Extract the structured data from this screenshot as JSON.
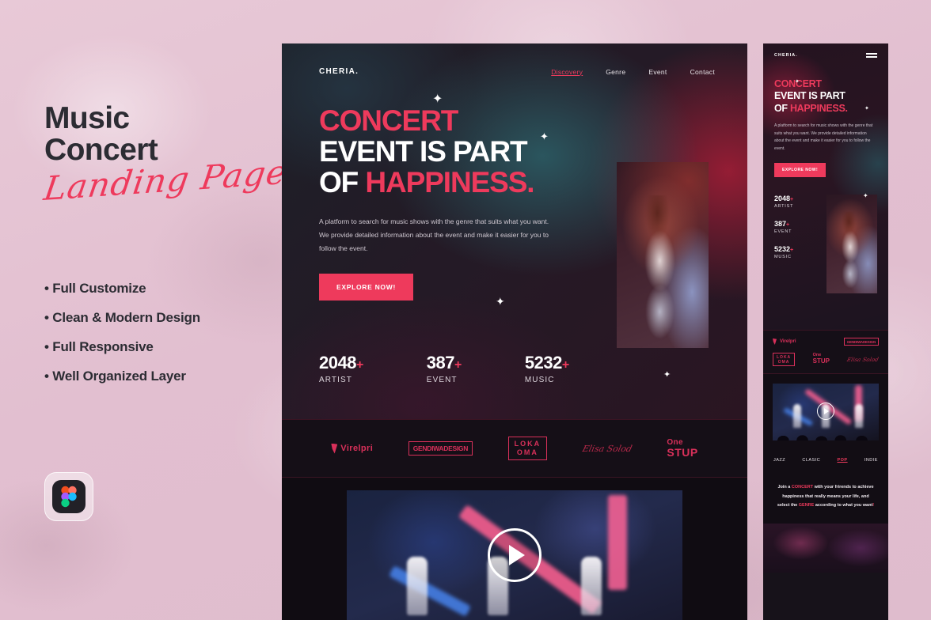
{
  "poster": {
    "title_line1": "Music",
    "title_line2": "Concert",
    "title_script": "Landing Page",
    "features": [
      "• Full Customize",
      "• Clean & Modern Design",
      "• Full Responsive",
      "• Well Organized Layer"
    ],
    "badge_icon": "figma-icon"
  },
  "colors": {
    "accent": "#ee3a5c",
    "background": "#e4c3d2",
    "dark": "#17121a",
    "text_dark": "#2c2c33"
  },
  "desktop": {
    "nav": {
      "brand": "CHERIA.",
      "links": [
        {
          "label": "Discovery",
          "active": true
        },
        {
          "label": "Genre",
          "active": false
        },
        {
          "label": "Event",
          "active": false
        },
        {
          "label": "Contact",
          "active": false
        }
      ]
    },
    "hero": {
      "headline_line1": "CONCERT",
      "headline_line2": "EVENT IS PART",
      "headline_line3_prefix": "OF ",
      "headline_line3_accent": "HAPPINESS.",
      "paragraph": "A platform to search for music shows with the genre that suits what you want. We provide detailed information about the event and make it easier for you to follow the event.",
      "cta": "EXPLORE NOW!",
      "image_alt": "concert-singer-photo"
    },
    "stats": [
      {
        "value": "2048",
        "plus": "+",
        "label": "ARTIST"
      },
      {
        "value": "387",
        "plus": "+",
        "label": "EVENT"
      },
      {
        "value": "5232",
        "plus": "+",
        "label": "MUSIC"
      }
    ],
    "logos": [
      {
        "name": "Virelpri",
        "style": "mark"
      },
      {
        "name": "GENDIWADESIGN",
        "style": "boxed"
      },
      {
        "name_line1": "LOKA",
        "name_line2": "OMA",
        "style": "loka"
      },
      {
        "name": "Elisa Solod",
        "style": "script"
      },
      {
        "name_line1": "One",
        "name_line2": "STUP",
        "style": "onestup"
      }
    ],
    "video": {
      "play_label": "play-button"
    }
  },
  "mobile": {
    "nav": {
      "brand": "CHERIA.",
      "menu_icon": "hamburger-menu-icon"
    },
    "hero": {
      "headline_line1": "CONCERT",
      "headline_line2": "EVENT IS PART",
      "headline_line3_prefix": "OF ",
      "headline_line3_accent": "HAPPINESS.",
      "paragraph": "A platform to search for music shows with the genre that suits what you want. We provide detailed information about the event and make it easier for you to follow the event.",
      "cta": "EXPLORE NOW!"
    },
    "stats": [
      {
        "value": "2048",
        "plus": "+",
        "label": "ARTIST"
      },
      {
        "value": "387",
        "plus": "+",
        "label": "EVENT"
      },
      {
        "value": "5232",
        "plus": "+",
        "label": "MUSIC"
      }
    ],
    "logos_row1": [
      {
        "name": "Virelpri",
        "style": "mark"
      },
      {
        "name": "GENDIWADESIGN",
        "style": "boxed"
      }
    ],
    "logos_row2": [
      {
        "name_line1": "LOKA",
        "name_line2": "OMA",
        "style": "loka"
      },
      {
        "name_line1": "One",
        "name_line2": "STUP",
        "style": "onestup"
      },
      {
        "name": "Elisa Solod",
        "style": "script"
      }
    ],
    "genres": [
      {
        "label": "JAZZ",
        "active": false
      },
      {
        "label": "CLASIC",
        "active": false
      },
      {
        "label": "POP",
        "active": true
      },
      {
        "label": "INDIE",
        "active": false
      }
    ],
    "tagline": {
      "p1": "Join a ",
      "a1": "CONCERT",
      "p2": " with your frirends to achieve happiness that really means your life, and select the ",
      "a2": "GENRE",
      "p3": " according to what you want",
      "a3": "!"
    }
  }
}
